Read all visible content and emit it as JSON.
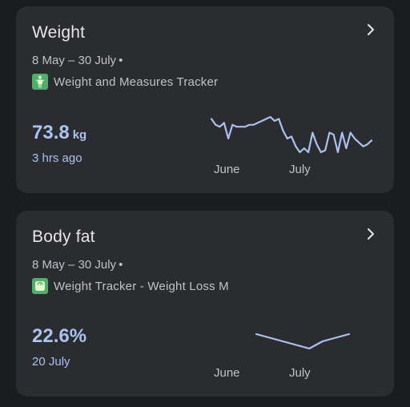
{
  "cards": [
    {
      "title": "Weight",
      "date_range": "8 May – 30 July",
      "dot": "•",
      "source": "Weight and Measures Tracker",
      "source_icon": "person-silhouette-icon",
      "value": "73.8",
      "unit": "kg",
      "time": "3 hrs ago",
      "axis_labels": [
        "June",
        "July"
      ]
    },
    {
      "title": "Body fat",
      "date_range": "8 May – 30 July",
      "dot": "•",
      "source": "Weight Tracker - Weight Loss M",
      "source_icon": "scale-icon",
      "value": "22.6%",
      "unit": "",
      "time": "20 July",
      "axis_labels": [
        "June",
        "July"
      ]
    }
  ],
  "colors": {
    "background": "#1b1c1f",
    "card": "#2b2c2f",
    "accent": "#a9c2f0",
    "text_primary": "#e6e6e9",
    "text_secondary": "#c1c2c6",
    "icon_green": "#4caf6a"
  },
  "chart_data": [
    {
      "type": "line",
      "series": [
        {
          "values": [
            74.6,
            74.3,
            74.2,
            74.4,
            73.6,
            74.3,
            74.2,
            74.2,
            74.2,
            74.3,
            74.3,
            74.4,
            74.5,
            74.6,
            74.7,
            74.5,
            74.6,
            74.0,
            73.6,
            73.7,
            73.2,
            72.9,
            73.1,
            72.9,
            73.9,
            73.3,
            72.9,
            73.0,
            73.9,
            73.8,
            72.9,
            73.9,
            73.1,
            73.9,
            73.6,
            73.4,
            73.2,
            73.3,
            73.5
          ]
        }
      ],
      "x_labels": [
        "June",
        "July"
      ]
    },
    {
      "type": "line",
      "series": [
        {
          "values": [
            22.9,
            22.8,
            22.7,
            22.6,
            22.5,
            22.7,
            22.8,
            22.9
          ]
        }
      ],
      "x_labels": [
        "June",
        "July"
      ]
    }
  ]
}
